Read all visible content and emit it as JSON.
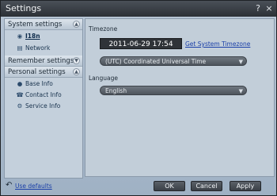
{
  "window": {
    "title": "Settings",
    "help_glyph": "?",
    "close_glyph": "×"
  },
  "sidebar": {
    "sections": [
      {
        "label": "System settings",
        "items": [
          {
            "label": "I18n",
            "icon": "globe-icon"
          },
          {
            "label": "Network",
            "icon": "network-icon"
          }
        ]
      },
      {
        "label": "Remember settings",
        "items": []
      },
      {
        "label": "Personal settings",
        "items": [
          {
            "label": "Base Info",
            "icon": "person-icon"
          },
          {
            "label": "Contact Info",
            "icon": "phone-icon"
          },
          {
            "label": "Service Info",
            "icon": "service-icon"
          }
        ]
      }
    ]
  },
  "content": {
    "timezone_label": "Timezone",
    "datetime_value": "2011-06-29 17:54",
    "get_timezone_link": "Get System Timezone",
    "timezone_select": "(UTC) Coordinated Universal Time",
    "language_label": "Language",
    "language_select": "English"
  },
  "footer": {
    "use_defaults_link": "Use defaults",
    "ok_label": "OK",
    "cancel_label": "Cancel",
    "apply_label": "Apply"
  }
}
